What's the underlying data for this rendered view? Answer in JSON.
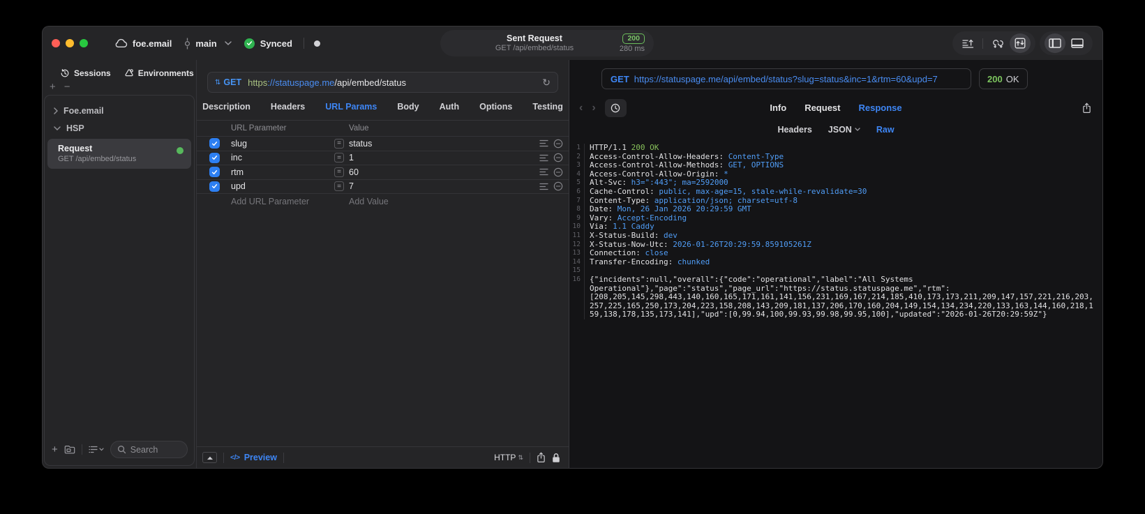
{
  "titlebar": {
    "project": "foe.email",
    "branch": "main",
    "sync_label": "Synced",
    "request_title": "Sent Request",
    "request_subtitle": "GET /api/embed/status",
    "status_code": "200",
    "duration": "280 ms"
  },
  "sidebar": {
    "tabs": [
      {
        "label": "Sessions",
        "icon": "history-icon"
      },
      {
        "label": "Environments",
        "icon": "environments-icon"
      }
    ],
    "groups": [
      {
        "label": "Foe.email",
        "state": "collapsed",
        "chevron": "›"
      },
      {
        "label": "HSP",
        "state": "expanded",
        "chevron": "⌄"
      }
    ],
    "request_item": {
      "title": "Request",
      "subtitle": "GET /api/embed/status"
    },
    "search_placeholder": "Search"
  },
  "request_panel": {
    "method": "GET",
    "url": {
      "scheme": "https",
      "host": "://statuspage.me",
      "path": "/api/embed/status"
    },
    "tabs": [
      {
        "label": "Description",
        "active": false
      },
      {
        "label": "Headers",
        "active": false
      },
      {
        "label": "URL Params",
        "active": true
      },
      {
        "label": "Body",
        "active": false
      },
      {
        "label": "Auth",
        "active": false
      },
      {
        "label": "Options",
        "active": false
      },
      {
        "label": "Testing",
        "active": false
      }
    ],
    "table": {
      "col_name": "URL Parameter",
      "col_value": "Value",
      "eq_symbol": "=",
      "rows": [
        {
          "name": "slug",
          "value": "status",
          "checked": true
        },
        {
          "name": "inc",
          "value": "1",
          "checked": true
        },
        {
          "name": "rtm",
          "value": "60",
          "checked": true
        },
        {
          "name": "upd",
          "value": "7",
          "checked": true
        }
      ],
      "add_name": "Add URL Parameter",
      "add_value": "Add Value"
    },
    "footer": {
      "code_glyph": "</>",
      "preview": "Preview",
      "protocol": "HTTP"
    }
  },
  "response_panel": {
    "request_method": "GET",
    "request_url": "https://statuspage.me/api/embed/status?slug=status&inc=1&rtm=60&upd=7",
    "status_code": "200",
    "status_text": "OK",
    "tabs": [
      {
        "label": "Info",
        "active": false
      },
      {
        "label": "Request",
        "active": false
      },
      {
        "label": "Response",
        "active": true
      }
    ],
    "subtabs": [
      {
        "label": "Headers",
        "active": false,
        "dropdown": false
      },
      {
        "label": "JSON",
        "active": false,
        "dropdown": true
      },
      {
        "label": "Raw",
        "active": true,
        "dropdown": false
      }
    ],
    "body_lines": [
      {
        "num": "1",
        "segments": [
          {
            "text": "HTTP/1.1 ",
            "color": "plain"
          },
          {
            "text": "200 OK",
            "color": "green"
          }
        ]
      },
      {
        "num": "2",
        "segments": [
          {
            "text": "Access-Control-Allow-Headers: ",
            "color": "plain"
          },
          {
            "text": "Content-Type",
            "color": "blue"
          }
        ]
      },
      {
        "num": "3",
        "segments": [
          {
            "text": "Access-Control-Allow-Methods: ",
            "color": "plain"
          },
          {
            "text": "GET, OPTIONS",
            "color": "blue"
          }
        ]
      },
      {
        "num": "4",
        "segments": [
          {
            "text": "Access-Control-Allow-Origin: ",
            "color": "plain"
          },
          {
            "text": "*",
            "color": "blue"
          }
        ]
      },
      {
        "num": "5",
        "segments": [
          {
            "text": "Alt-Svc: ",
            "color": "plain"
          },
          {
            "text": "h3=\":443\"; ma=2592000",
            "color": "blue"
          }
        ]
      },
      {
        "num": "6",
        "segments": [
          {
            "text": "Cache-Control: ",
            "color": "plain"
          },
          {
            "text": "public, max-age=15, stale-while-revalidate=30",
            "color": "blue"
          }
        ]
      },
      {
        "num": "7",
        "segments": [
          {
            "text": "Content-Type: ",
            "color": "plain"
          },
          {
            "text": "application/json; charset=utf-8",
            "color": "blue"
          }
        ]
      },
      {
        "num": "8",
        "segments": [
          {
            "text": "Date: ",
            "color": "plain"
          },
          {
            "text": "Mon, 26 Jan 2026 20:29:59 GMT",
            "color": "blue"
          }
        ]
      },
      {
        "num": "9",
        "segments": [
          {
            "text": "Vary: ",
            "color": "plain"
          },
          {
            "text": "Accept-Encoding",
            "color": "blue"
          }
        ]
      },
      {
        "num": "10",
        "segments": [
          {
            "text": "Via: ",
            "color": "plain"
          },
          {
            "text": "1.1 Caddy",
            "color": "blue"
          }
        ]
      },
      {
        "num": "11",
        "segments": [
          {
            "text": "X-Status-Build: ",
            "color": "plain"
          },
          {
            "text": "dev",
            "color": "blue"
          }
        ]
      },
      {
        "num": "12",
        "segments": [
          {
            "text": "X-Status-Now-Utc: ",
            "color": "plain"
          },
          {
            "text": "2026-01-26T20:29:59.859105261Z",
            "color": "blue"
          }
        ]
      },
      {
        "num": "13",
        "segments": [
          {
            "text": "Connection: ",
            "color": "plain"
          },
          {
            "text": "close",
            "color": "blue"
          }
        ]
      },
      {
        "num": "14",
        "segments": [
          {
            "text": "Transfer-Encoding: ",
            "color": "plain"
          },
          {
            "text": "chunked",
            "color": "blue"
          }
        ]
      },
      {
        "num": "15",
        "segments": []
      },
      {
        "num": "16",
        "segments": [
          {
            "text": "{\"incidents\":null,\"overall\":{\"code\":\"operational\",\"label\":\"All Systems Operational\"},\"page\":\"status\",\"page_url\":\"https://status.statuspage.me\",\"rtm\":[208,205,145,298,443,140,160,165,171,161,141,156,231,169,167,214,185,410,173,173,211,209,147,157,221,216,203,257,225,165,250,173,204,223,158,208,143,209,181,137,206,170,160,204,149,154,134,234,220,133,163,144,160,218,159,138,178,135,173,141],\"upd\":[0,99.94,100,99.93,99.98,99.95,100],\"updated\":\"2026-01-26T20:29:59Z\"}",
            "color": "plain"
          }
        ]
      }
    ]
  }
}
